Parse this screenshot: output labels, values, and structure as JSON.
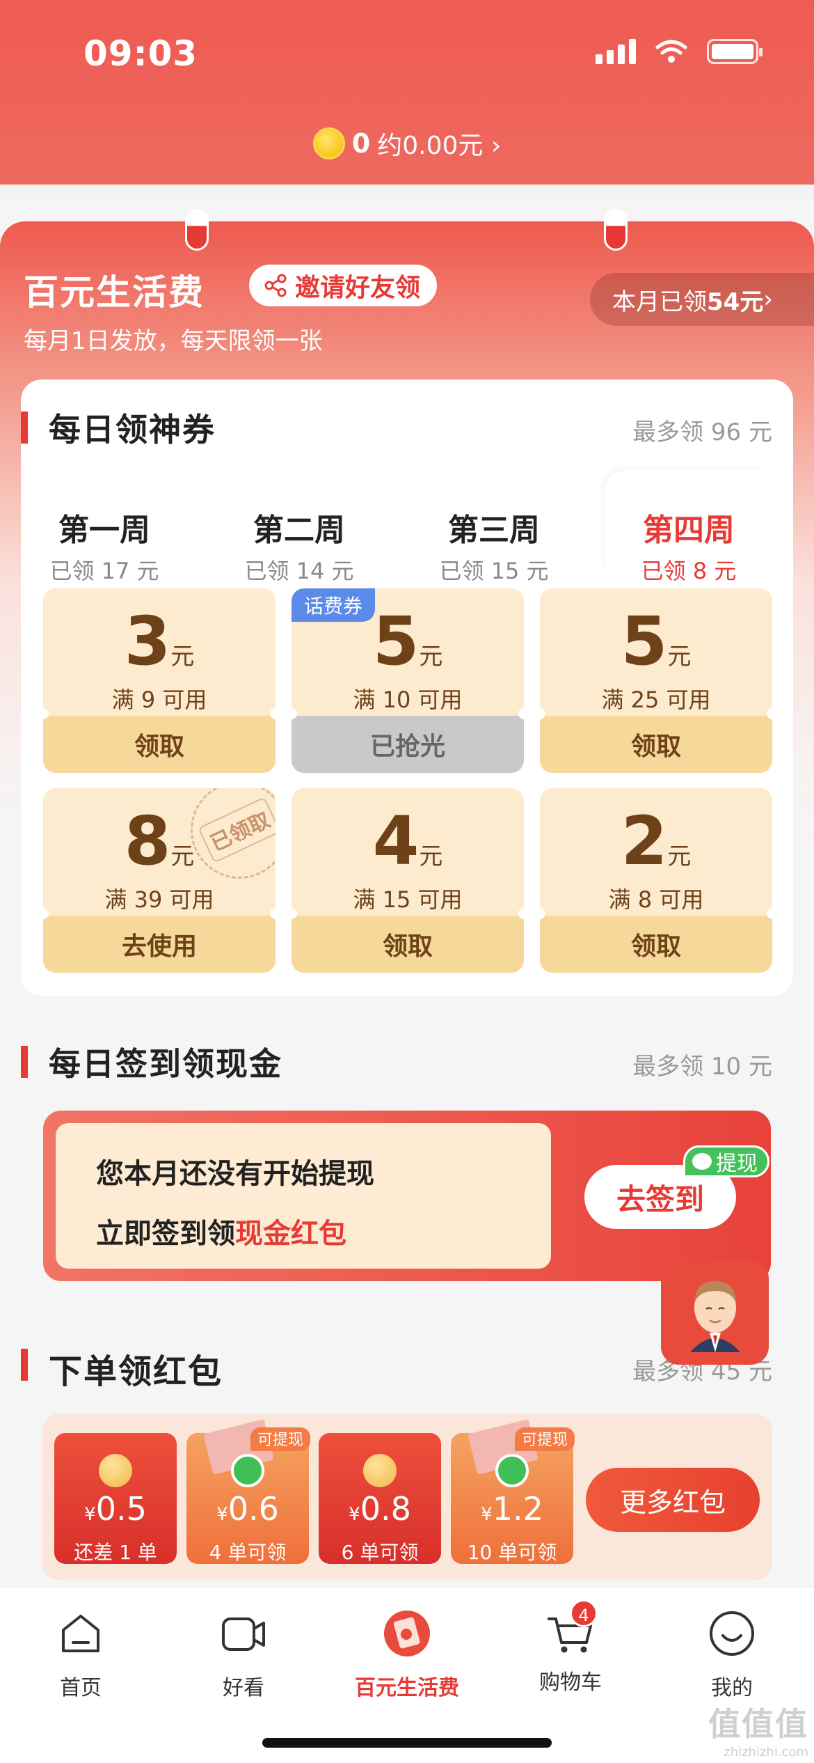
{
  "status": {
    "time": "09:03"
  },
  "header": {
    "coin_count": "0",
    "coin_value": "约0.00元 ›"
  },
  "life": {
    "title": "百元生活费",
    "invite_label": "邀请好友领",
    "subtitle": "每月1日发放，每天限领一张",
    "month_prefix": "本月已领",
    "month_amount": "54元",
    "month_suffix": " ›"
  },
  "daily": {
    "title": "每日领神券",
    "max": "最多领 96 元",
    "weeks": [
      {
        "label": "第一周",
        "sub": "已领 17 元"
      },
      {
        "label": "第二周",
        "sub": "已领 14 元"
      },
      {
        "label": "第三周",
        "sub": "已领 15 元"
      },
      {
        "label": "第四周",
        "sub": "已领 8 元"
      }
    ],
    "coupons": [
      {
        "amount": "3",
        "unit": "元",
        "cond": "满 9 可用",
        "btn": "领取"
      },
      {
        "amount": "5",
        "unit": "元",
        "cond": "满 10 可用",
        "btn": "已抢光",
        "tag": "话费券"
      },
      {
        "amount": "5",
        "unit": "元",
        "cond": "满 25 可用",
        "btn": "领取"
      },
      {
        "amount": "8",
        "unit": "元",
        "cond": "满 39 可用",
        "btn": "去使用",
        "stamp": "已领取"
      },
      {
        "amount": "4",
        "unit": "元",
        "cond": "满 15 可用",
        "btn": "领取"
      },
      {
        "amount": "2",
        "unit": "元",
        "cond": "满 8 可用",
        "btn": "领取"
      }
    ]
  },
  "signin": {
    "title": "每日签到领现金",
    "max": "最多领 10 元",
    "line1": "您本月还没有开始提现",
    "line2_prefix": "立即签到领",
    "line2_highlight": "现金红包",
    "button": "去签到",
    "tag": "提现"
  },
  "order": {
    "title": "下单领红包",
    "max": "最多领 45 元",
    "packets": [
      {
        "value": "0.5",
        "sub": "还差 1 单",
        "tag": ""
      },
      {
        "value": "0.6",
        "sub": "4 单可领",
        "tag": "可提现"
      },
      {
        "value": "0.8",
        "sub": "6 单可领",
        "tag": ""
      },
      {
        "value": "1.2",
        "sub": "10 单可领",
        "tag": "可提现"
      }
    ],
    "currency": "¥",
    "more_button": "更多红包"
  },
  "tabs": [
    {
      "label": "首页"
    },
    {
      "label": "好看"
    },
    {
      "label": "百元生活费"
    },
    {
      "label": "购物车",
      "badge": "4"
    },
    {
      "label": "我的"
    }
  ],
  "watermark": {
    "logo": "值值值",
    "url": "zhizhizhi.com"
  },
  "colors": {
    "brand_red": "#e83a35",
    "coupon_bg": "#fdebcf",
    "coupon_btn": "#f6d89a"
  }
}
